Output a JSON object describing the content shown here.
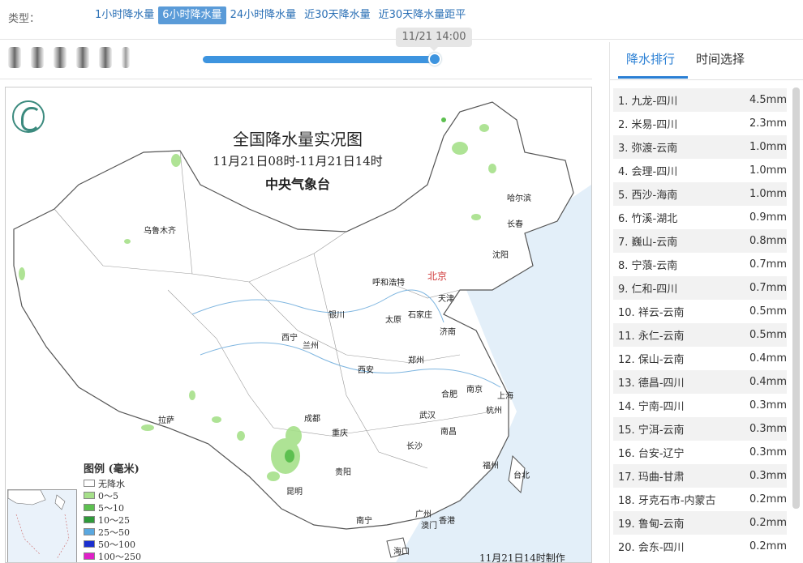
{
  "type_bar": {
    "label": "类型：",
    "tabs": [
      {
        "label": "1小时降水量",
        "active": false
      },
      {
        "label": "6小时降水量",
        "active": true
      },
      {
        "label": "24小时降水量",
        "active": false
      },
      {
        "label": "近30天降水量",
        "active": false
      },
      {
        "label": "近30天降水量距平",
        "active": false
      }
    ]
  },
  "timeline": {
    "tooltip": "11/21 14:00",
    "progress": 1.0
  },
  "map": {
    "title": "全国降水量实况图",
    "subtitle": "11月21日08时-11月21日14时",
    "org": "中央气象台",
    "made_at": "11月21日14时制作",
    "cities": [
      {
        "name": "乌鲁木齐"
      },
      {
        "name": "哈尔滨"
      },
      {
        "name": "长春"
      },
      {
        "name": "沈阳"
      },
      {
        "name": "呼和浩特"
      },
      {
        "name": "北京",
        "capital": true
      },
      {
        "name": "天津"
      },
      {
        "name": "银川"
      },
      {
        "name": "太原"
      },
      {
        "name": "石家庄"
      },
      {
        "name": "济南"
      },
      {
        "name": "西宁"
      },
      {
        "name": "兰州"
      },
      {
        "name": "西安"
      },
      {
        "name": "郑州"
      },
      {
        "name": "合肥"
      },
      {
        "name": "南京"
      },
      {
        "name": "上海"
      },
      {
        "name": "杭州"
      },
      {
        "name": "拉萨"
      },
      {
        "name": "成都"
      },
      {
        "name": "重庆"
      },
      {
        "name": "武汉"
      },
      {
        "name": "南昌"
      },
      {
        "name": "长沙"
      },
      {
        "name": "福州"
      },
      {
        "name": "台北"
      },
      {
        "name": "贵阳"
      },
      {
        "name": "昆明"
      },
      {
        "name": "南宁"
      },
      {
        "name": "广州"
      },
      {
        "name": "澳门"
      },
      {
        "name": "香港"
      },
      {
        "name": "海口"
      }
    ],
    "legend": {
      "title": "图例 (毫米)",
      "items": [
        {
          "label": "无降水",
          "color": "#ffffff"
        },
        {
          "label": "0～5",
          "color": "#a6e08a"
        },
        {
          "label": "5～10",
          "color": "#5dc050"
        },
        {
          "label": "10～25",
          "color": "#2f9a3a"
        },
        {
          "label": "25～50",
          "color": "#5aa8e0"
        },
        {
          "label": "50～100",
          "color": "#1a2fd0"
        },
        {
          "label": "100～250",
          "color": "#e020c8"
        }
      ]
    }
  },
  "panel": {
    "tabs": [
      {
        "label": "降水排行",
        "active": true
      },
      {
        "label": "时间选择",
        "active": false
      }
    ],
    "ranking": [
      {
        "rank": "1.",
        "station": "九龙-四川",
        "value": "4.5mm"
      },
      {
        "rank": "2.",
        "station": "米易-四川",
        "value": "2.3mm"
      },
      {
        "rank": "3.",
        "station": "弥渡-云南",
        "value": "1.0mm"
      },
      {
        "rank": "4.",
        "station": "会理-四川",
        "value": "1.0mm"
      },
      {
        "rank": "5.",
        "station": "西沙-海南",
        "value": "1.0mm"
      },
      {
        "rank": "6.",
        "station": "竹溪-湖北",
        "value": "0.9mm"
      },
      {
        "rank": "7.",
        "station": "巍山-云南",
        "value": "0.8mm"
      },
      {
        "rank": "8.",
        "station": "宁蒗-云南",
        "value": "0.7mm"
      },
      {
        "rank": "9.",
        "station": "仁和-四川",
        "value": "0.7mm"
      },
      {
        "rank": "10.",
        "station": "祥云-云南",
        "value": "0.5mm"
      },
      {
        "rank": "11.",
        "station": "永仁-云南",
        "value": "0.5mm"
      },
      {
        "rank": "12.",
        "station": "保山-云南",
        "value": "0.4mm"
      },
      {
        "rank": "13.",
        "station": "德昌-四川",
        "value": "0.4mm"
      },
      {
        "rank": "14.",
        "station": "宁南-四川",
        "value": "0.3mm"
      },
      {
        "rank": "15.",
        "station": "宁洱-云南",
        "value": "0.3mm"
      },
      {
        "rank": "16.",
        "station": "台安-辽宁",
        "value": "0.3mm"
      },
      {
        "rank": "17.",
        "station": "玛曲-甘肃",
        "value": "0.3mm"
      },
      {
        "rank": "18.",
        "station": "牙克石市-内蒙古",
        "value": "0.2mm"
      },
      {
        "rank": "19.",
        "station": "鲁甸-云南",
        "value": "0.2mm"
      },
      {
        "rank": "20.",
        "station": "会东-四川",
        "value": "0.2mm"
      }
    ]
  }
}
